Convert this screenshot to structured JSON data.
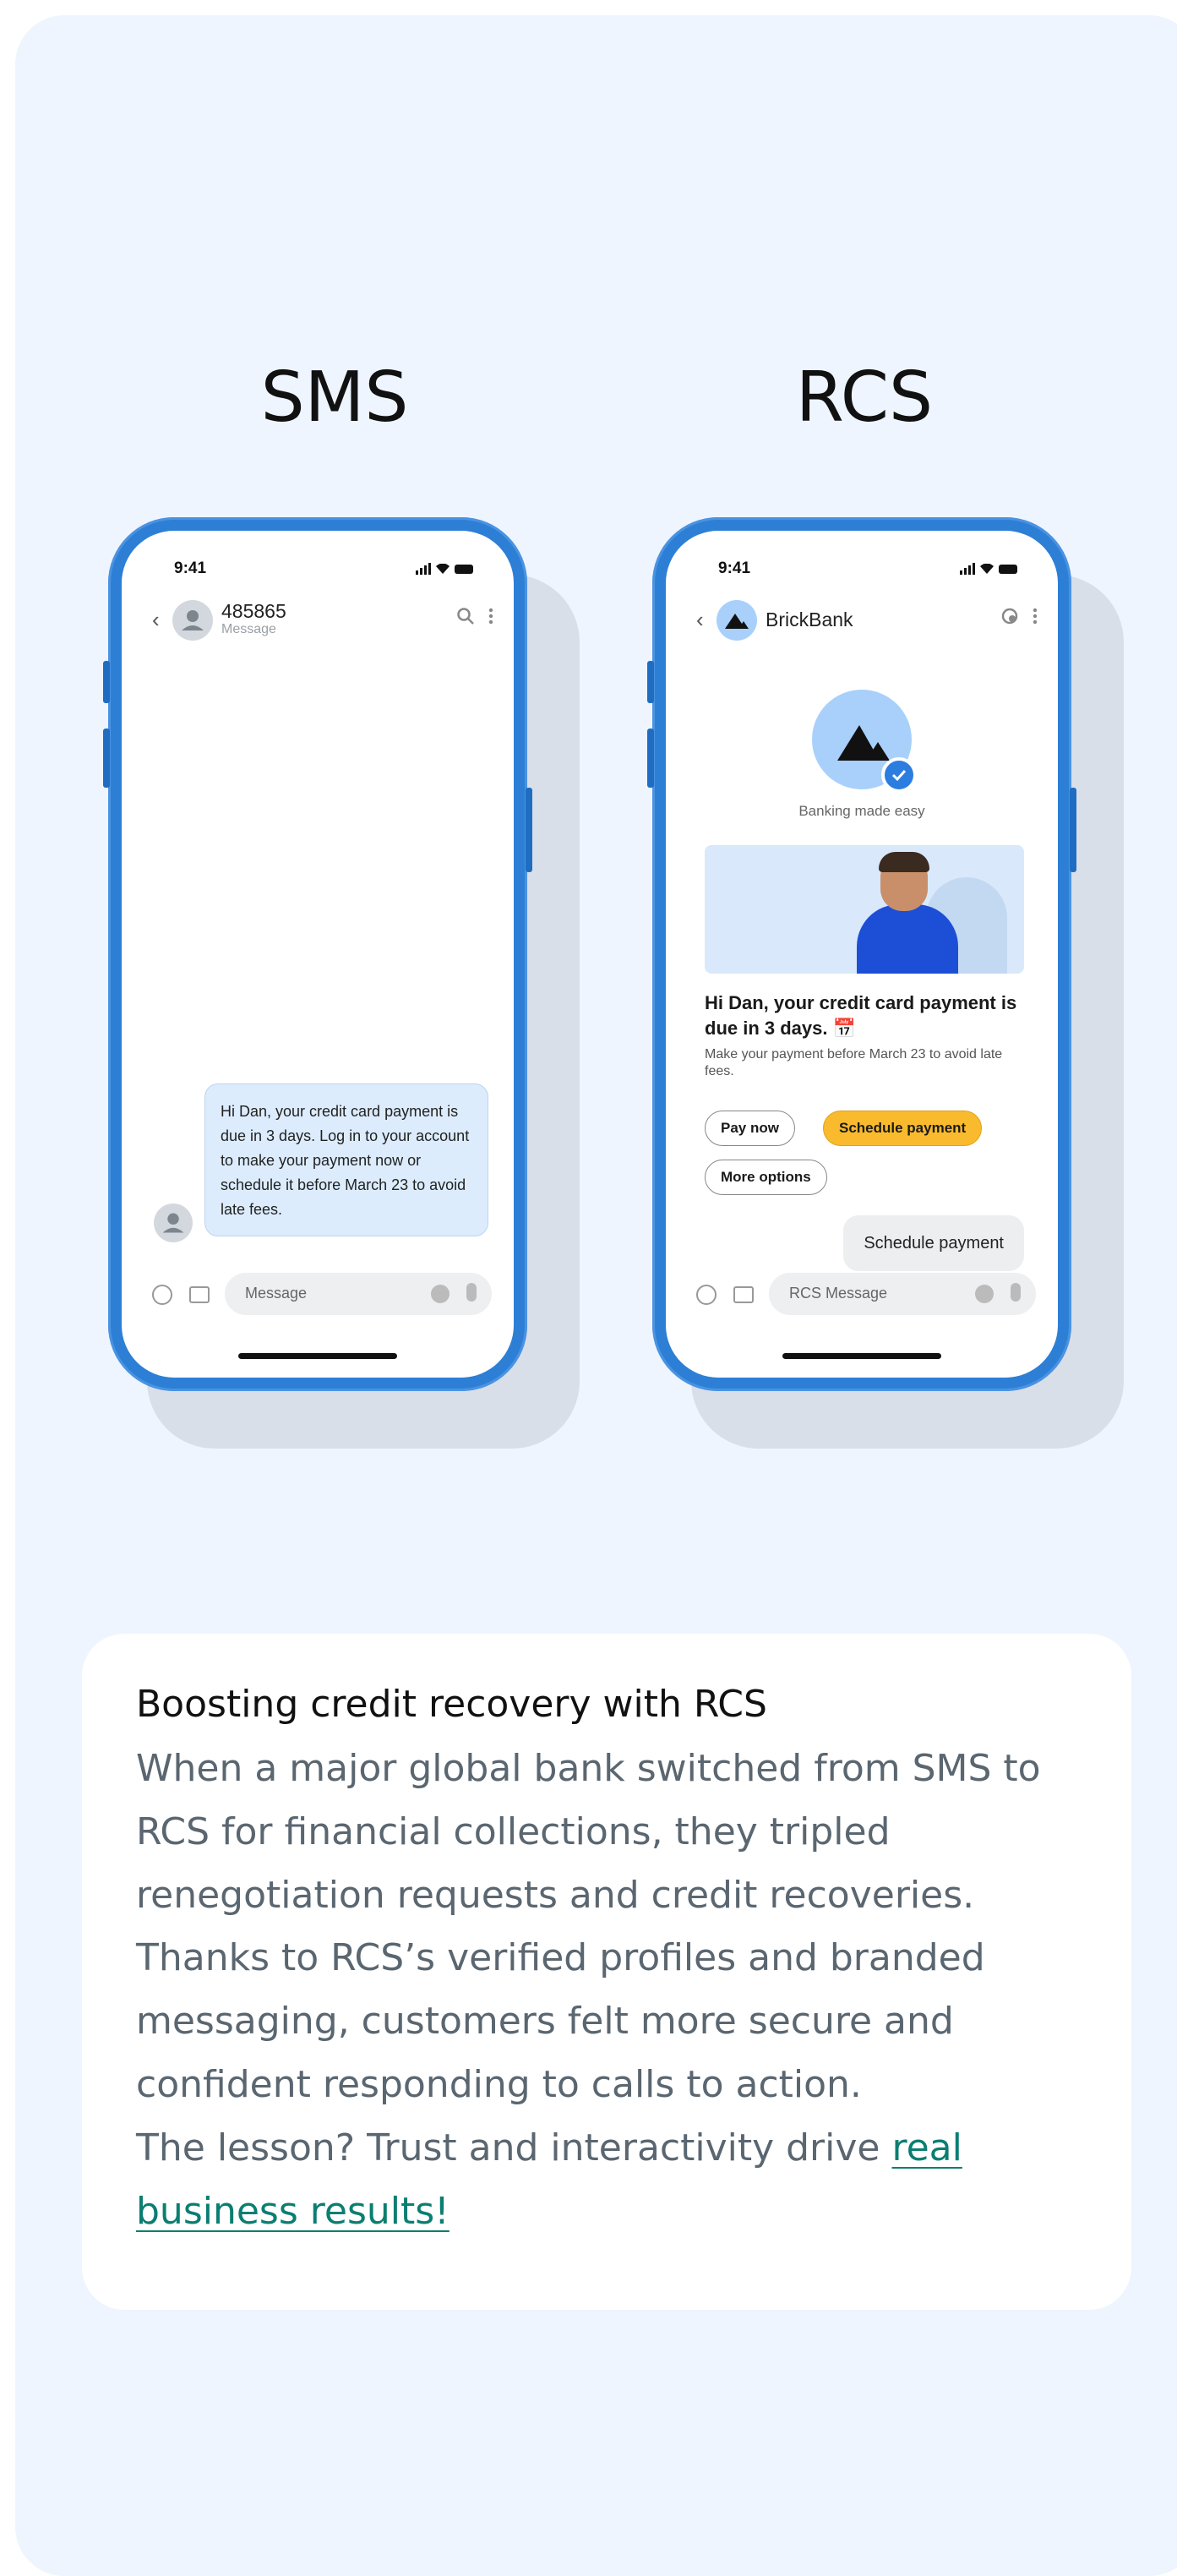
{
  "sms": {
    "title": "SMS",
    "time": "9:41",
    "sender": "485865",
    "sender_sub": "Message",
    "message": "Hi Dan, your credit card payment is due in 3 days. Log in to your account to make your payment now or schedule it before March 23 to avoid late fees.",
    "composer_placeholder": "Message"
  },
  "rcs": {
    "title": "RCS",
    "time": "9:41",
    "sender": "BrickBank",
    "tagline": "Banking made easy",
    "card_title": "Hi Dan, your credit card payment is due in 3 days. 📅",
    "card_sub": "Make your payment before March 23 to avoid late fees.",
    "actions": [
      "Pay now",
      "Schedule payment",
      "More options"
    ],
    "user_reply": "Schedule payment",
    "composer_placeholder": "RCS Message",
    "accent_color": "#f9bb2d"
  },
  "info": {
    "title": "Boosting credit recovery with RCS",
    "p1": "When a major global bank switched from SMS to RCS for financial collections, they tripled renegotiation requests and credit recoveries. Thanks to RCS’s verified profiles and branded messaging, customers felt more secure and confident responding to calls to action.",
    "p2_prefix": "The lesson? Trust and interactivity drive ",
    "p2_link": "real business results!",
    "link_color": "#0b7e72"
  }
}
